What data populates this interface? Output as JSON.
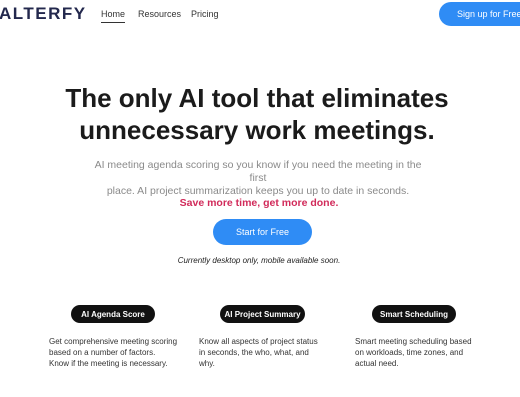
{
  "nav": {
    "logo": "ALTERFY",
    "links": [
      "Home",
      "Resources",
      "Pricing"
    ],
    "signup_label": "Sign up for Free"
  },
  "hero": {
    "headline_line1": "The only AI tool that eliminates",
    "headline_line2": "unnecessary work meetings.",
    "subtext_line1": "AI meeting agenda scoring so you know if you need the meeting in the first",
    "subtext_line2": "place. AI project summarization keeps you up to date in seconds.",
    "tagline": "Save more time, get more done.",
    "cta_label": "Start for Free",
    "note": "Currently desktop only, mobile available soon."
  },
  "features": [
    {
      "title": "AI Agenda Score",
      "desc_lines": [
        "Get comprehensive meeting scoring",
        "based on a number of factors.",
        "Know if the meeting is necessary."
      ]
    },
    {
      "title": "AI Project Summary",
      "desc_lines": [
        "Know all aspects of project status",
        "in seconds, the who, what, and",
        "why."
      ]
    },
    {
      "title": "Smart Scheduling",
      "desc_lines": [
        "Smart meeting scheduling based",
        "on workloads, time zones, and",
        "actual need."
      ]
    }
  ],
  "colors": {
    "accent_blue": "#2f8cf5",
    "tagline_pink": "#d12a5a",
    "badge_black": "#111111"
  }
}
